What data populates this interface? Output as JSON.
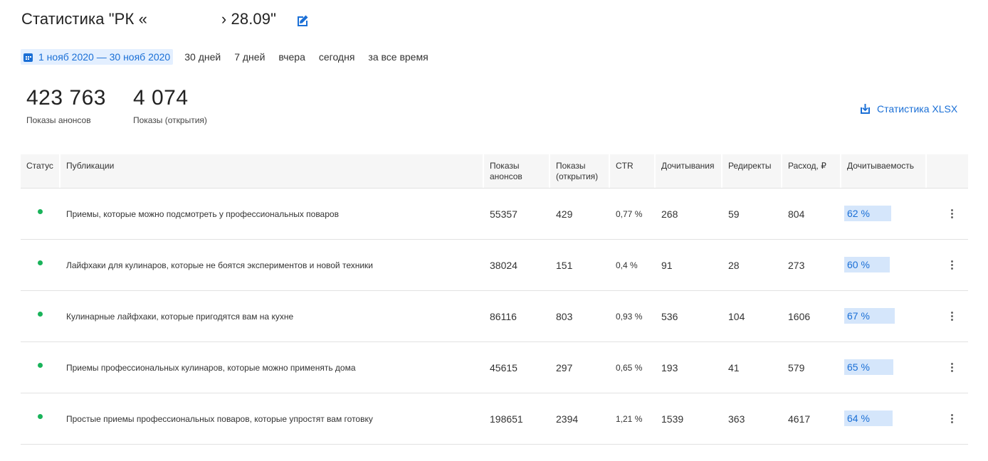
{
  "header": {
    "title_prefix": "Статистика \"РК «",
    "title_suffix": "› 28.09\""
  },
  "periods": {
    "active": "1 нояб 2020 — 30 нояб 2020",
    "options": [
      "30 дней",
      "7 дней",
      "вчера",
      "сегодня",
      "за все время"
    ]
  },
  "kpis": [
    {
      "value": "423 763",
      "label": "Показы анонсов"
    },
    {
      "value": "4 074",
      "label": "Показы (открытия)"
    }
  ],
  "export": {
    "label": "Статистика XLSX"
  },
  "table": {
    "headers": {
      "status": "Статус",
      "pub": "Публикации",
      "shows": "Показы анонсов",
      "open": "Показы (открытия)",
      "ctr": "CTR",
      "read": "Дочитывания",
      "red": "Редиректы",
      "cost": "Расход, ₽",
      "rate": "Дочитываемость"
    },
    "rows": [
      {
        "pub": "Приемы, которые можно подсмотреть у профессиональных поваров",
        "shows": "55357",
        "open": "429",
        "ctr": "0,77 %",
        "read": "268",
        "red": "59",
        "cost": "804",
        "rate": "62 %",
        "rate_value": 0.62
      },
      {
        "pub": "Лайфхаки для кулинаров, которые не боятся экспериментов и новой техники",
        "shows": "38024",
        "open": "151",
        "ctr": "0,4 %",
        "read": "91",
        "red": "28",
        "cost": "273",
        "rate": "60 %",
        "rate_value": 0.6
      },
      {
        "pub": "Кулинарные лайфхаки, которые пригодятся вам на кухне",
        "shows": "86116",
        "open": "803",
        "ctr": "0,93 %",
        "read": "536",
        "red": "104",
        "cost": "1606",
        "rate": "67 %",
        "rate_value": 0.67
      },
      {
        "pub": "Приемы профессиональных кулинаров, которые можно применять дома",
        "shows": "45615",
        "open": "297",
        "ctr": "0,65 %",
        "read": "193",
        "red": "41",
        "cost": "579",
        "rate": "65 %",
        "rate_value": 0.65
      },
      {
        "pub": "Простые приемы профессиональных поваров, которые упростят вам готовку",
        "shows": "198651",
        "open": "2394",
        "ctr": "1,21 %",
        "read": "1539",
        "red": "363",
        "cost": "4617",
        "rate": "64 %",
        "rate_value": 0.64
      }
    ]
  },
  "colors": {
    "accent": "#1a6fd6",
    "status_active": "#19b35a",
    "rate_bar": "#d5e6fb"
  }
}
